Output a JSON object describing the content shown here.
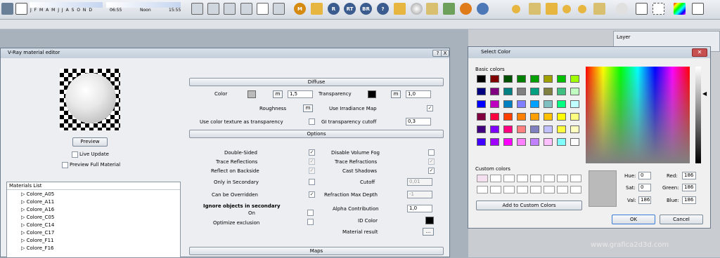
{
  "toolbar": {
    "months": "J F M A M J J A S O N D",
    "time_start": "06:55",
    "time_noon": "Noon",
    "time_end": "15:55",
    "round_buttons": [
      "M",
      "R",
      "RT",
      "BR",
      "?"
    ]
  },
  "layer_panel": {
    "title": "Layer"
  },
  "vray": {
    "title": "V-Ray material editor",
    "help": "?",
    "close": "X",
    "preview_button": "Preview",
    "live_update": "Live Update",
    "preview_full": "Preview Full Material",
    "materials_list": {
      "header": "Materials List",
      "items": [
        "Colore_A05",
        "Colore_A11",
        "Colore_A16",
        "Colore_C05",
        "Colore_C14",
        "Colore_C17",
        "Colore_F11",
        "Colore_F16"
      ]
    },
    "diffuse": {
      "header": "Diffuse",
      "color_label": "Color",
      "color_m": "m",
      "color_value": "1,5",
      "transparency_label": "Transparency",
      "transparency_m": "m",
      "transparency_value": "1,0",
      "roughness_label": "Roughness",
      "roughness_m": "m",
      "use_irradiance": "Use Irradiance Map",
      "use_color_texture": "Use color texture as transparency",
      "gi_cutoff_label": "GI transparency cutoff",
      "gi_cutoff_value": "0,3"
    },
    "options": {
      "header": "Options",
      "double_sided": "Double-Sided",
      "trace_reflections": "Trace Reflections",
      "reflect_backside": "Reflect on Backside",
      "only_secondary": "Only in Secondary",
      "can_be_overridden": "Can be Overridden",
      "ignore_header": "Ignore objects in secondary",
      "on": "On",
      "optimize_exclusion": "Optimize exclusion",
      "disable_volume_fog": "Disable Volume Fog",
      "trace_refractions": "Trace Refractions",
      "cast_shadows": "Cast Shadows",
      "cutoff_label": "Cutoff",
      "cutoff_value": "0,01",
      "refraction_max_depth_label": "Refraction Max Depth",
      "refraction_max_depth_value": "-1",
      "alpha_contribution_label": "Alpha Contribution",
      "alpha_contribution_value": "1,0",
      "id_color_label": "ID Color",
      "material_result_label": "Material result",
      "material_result_btn": "..."
    },
    "maps": {
      "header": "Maps"
    }
  },
  "select_color": {
    "title": "Select Color",
    "basic_colors_label": "Basic colors",
    "basic_colors": [
      "#000000",
      "#800000",
      "#005000",
      "#008000",
      "#00a000",
      "#a0a000",
      "#00c000",
      "#a0ff00",
      "#000080",
      "#800080",
      "#008080",
      "#808080",
      "#00a080",
      "#808040",
      "#40c080",
      "#c0ffc0",
      "#0000ff",
      "#c000c0",
      "#0080c0",
      "#8080ff",
      "#00a0ff",
      "#80c0c0",
      "#00ff80",
      "#c0ffff",
      "#800040",
      "#ff0040",
      "#ff4000",
      "#ff8000",
      "#ffa000",
      "#ffc000",
      "#ffff00",
      "#ffff80",
      "#400080",
      "#8000ff",
      "#ff0080",
      "#ff8080",
      "#8080c0",
      "#c0c0ff",
      "#ffff40",
      "#ffffc0",
      "#4000ff",
      "#a000ff",
      "#ff00ff",
      "#ff80ff",
      "#c080ff",
      "#ffc0ff",
      "#80ffff",
      "#ffffff"
    ],
    "custom_colors_label": "Custom colors",
    "custom_colors": [
      "#f4e0ee",
      "#ffffff",
      "#ffffff",
      "#ffffff",
      "#ffffff",
      "#ffffff",
      "#ffffff",
      "#ffffff",
      "#ffffff",
      "#ffffff",
      "#ffffff",
      "#ffffff",
      "#ffffff",
      "#ffffff",
      "#ffffff",
      "#ffffff"
    ],
    "add_custom": "Add to Custom Colors",
    "hue_label": "Hue:",
    "hue": "0",
    "sat_label": "Sat:",
    "sat": "0",
    "val_label": "Val:",
    "val": "186",
    "red_label": "Red:",
    "red": "186",
    "green_label": "Green:",
    "green": "186",
    "blue_label": "Blue:",
    "blue": "186",
    "preview_color": "#bababa",
    "ok": "OK",
    "cancel": "Cancel"
  },
  "watermark": "www.grafica2d3d.com"
}
